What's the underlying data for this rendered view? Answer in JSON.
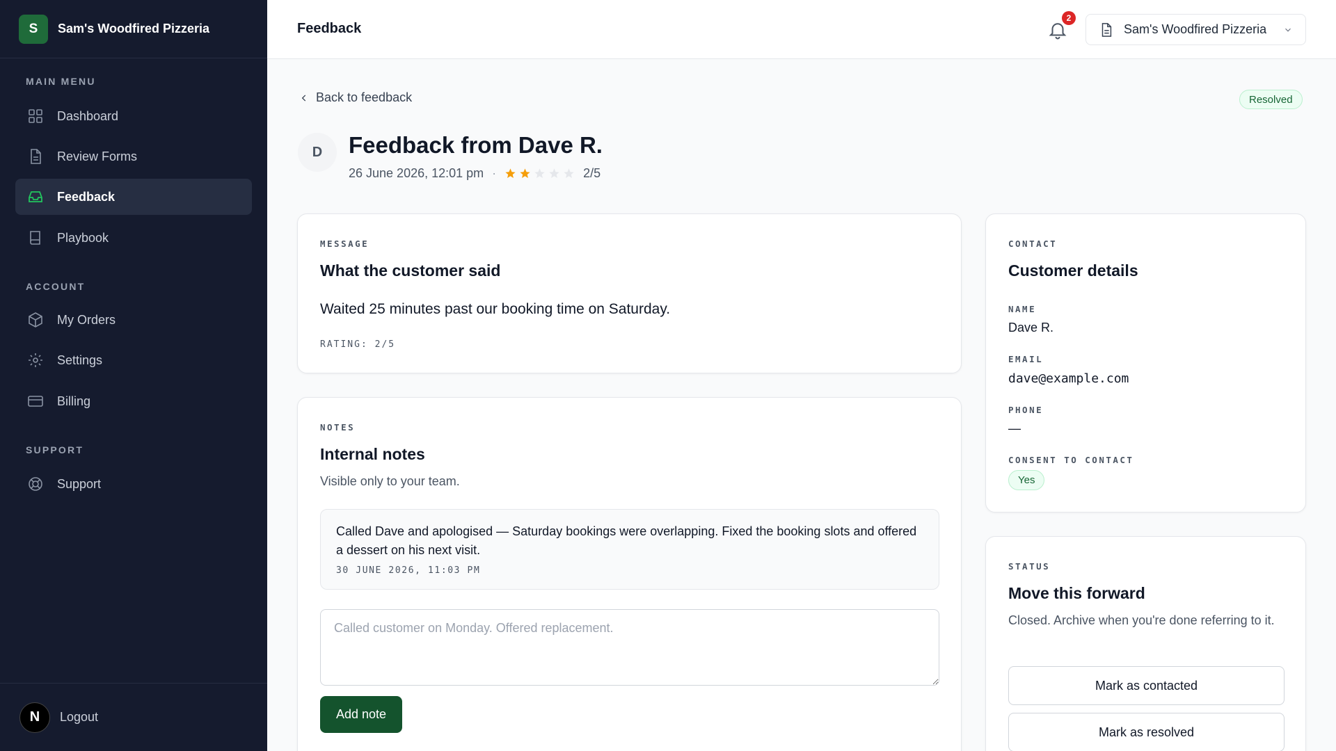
{
  "sidebar": {
    "brand_initial": "S",
    "brand_name": "Sam's Woodfired Pizzeria",
    "sections": {
      "main": "MAIN MENU",
      "account": "ACCOUNT",
      "support": "SUPPORT"
    },
    "items": {
      "dashboard": "Dashboard",
      "review_forms": "Review Forms",
      "feedback": "Feedback",
      "playbook": "Playbook",
      "my_orders": "My Orders",
      "settings": "Settings",
      "billing": "Billing",
      "support": "Support"
    },
    "footer": {
      "avatar_initial": "N",
      "logout": "Logout"
    }
  },
  "topbar": {
    "title": "Feedback",
    "notification_count": "2",
    "org_name": "Sam's Woodfired Pizzeria"
  },
  "detail": {
    "back_label": "Back to feedback",
    "status_badge": "Resolved",
    "avatar_initial": "D",
    "title": "Feedback from Dave R.",
    "date": "26 June 2026, 12:01 pm",
    "separator": "·",
    "rating": 2,
    "rating_max": 5,
    "rating_text": "2/5"
  },
  "message_card": {
    "eyebrow": "MESSAGE",
    "title": "What the customer said",
    "body": "Waited 25 minutes past our booking time on Saturday.",
    "rating_line": "RATING: 2/5"
  },
  "notes_card": {
    "eyebrow": "NOTES",
    "title": "Internal notes",
    "subtitle": "Visible only to your team.",
    "note_text": "Called Dave and apologised — Saturday bookings were overlapping. Fixed the booking slots and offered a dessert on his next visit.",
    "note_timestamp": "30 JUNE 2026, 11:03 PM",
    "input_placeholder": "Called customer on Monday. Offered replacement.",
    "add_button": "Add note"
  },
  "contact_card": {
    "eyebrow": "CONTACT",
    "title": "Customer details",
    "name_label": "NAME",
    "name_value": "Dave R.",
    "email_label": "EMAIL",
    "email_value": "dave@example.com",
    "phone_label": "PHONE",
    "phone_value": "—",
    "consent_label": "CONSENT TO CONTACT",
    "consent_value": "Yes"
  },
  "status_card": {
    "eyebrow": "STATUS",
    "title": "Move this forward",
    "body": "Closed. Archive when you're done referring to it.",
    "btn_contacted": "Mark as contacted",
    "btn_resolved": "Mark as resolved"
  },
  "colors": {
    "sidebar_bg": "#151b2e",
    "accent_green": "#14532d",
    "brand_green": "#1f6b3a",
    "star_filled": "#f59e0b",
    "star_empty": "#e5e7eb",
    "badge_red": "#dc2626"
  }
}
